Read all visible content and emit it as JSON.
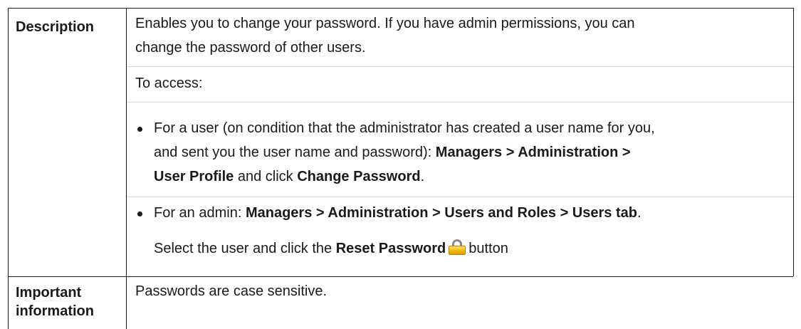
{
  "rows": [
    {
      "header": "Description",
      "paragraphs": {
        "intro_line1": "Enables you to change your password. If you have admin permissions, you can",
        "intro_line2": "change the password of other users.",
        "access": "To access:"
      },
      "bullet1": {
        "line1": "For a user (on condition that the administrator has created a user name for you,",
        "line2_a": "and sent you the user name and password): ",
        "line2_b": "Managers > Administration >",
        "line3_a": "User Profile",
        "line3_b": " and click ",
        "line3_c": "Change Password",
        "line3_d": "."
      },
      "bullet2": {
        "line1_a": "For an admin: ",
        "line1_b": "Managers > Administration > Users and Roles > Users tab",
        "line1_c": ".",
        "line2_a": "Select the user and click the ",
        "line2_b": "Reset Password",
        "line2_c": "button"
      },
      "icons": [
        "lock-icon"
      ]
    },
    {
      "header_line1": "Important",
      "header_line2": "information",
      "text": "Passwords are case sensitive."
    }
  ]
}
